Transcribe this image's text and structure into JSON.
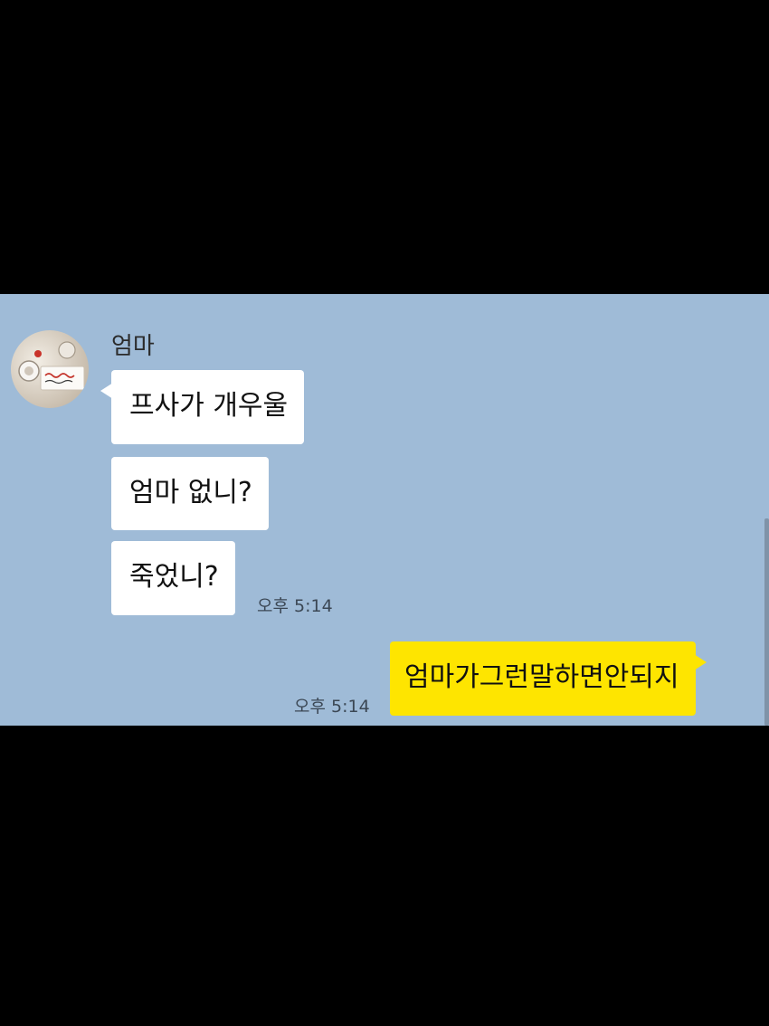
{
  "chat": {
    "sender": {
      "name": "엄마",
      "avatar_icon": "profile-photo-icon"
    },
    "incoming_messages": [
      {
        "text": "프사가 개우울"
      },
      {
        "text": "엄마 없니?"
      },
      {
        "text": "죽었니?"
      }
    ],
    "incoming_time": "오후 5:14",
    "outgoing_messages": [
      {
        "text": "엄마가그런말하면안되지"
      }
    ],
    "outgoing_time": "오후 5:14",
    "colors": {
      "background": "#9fbbd7",
      "incoming_bubble": "#ffffff",
      "outgoing_bubble": "#fee500",
      "letterbox": "#000000"
    }
  }
}
